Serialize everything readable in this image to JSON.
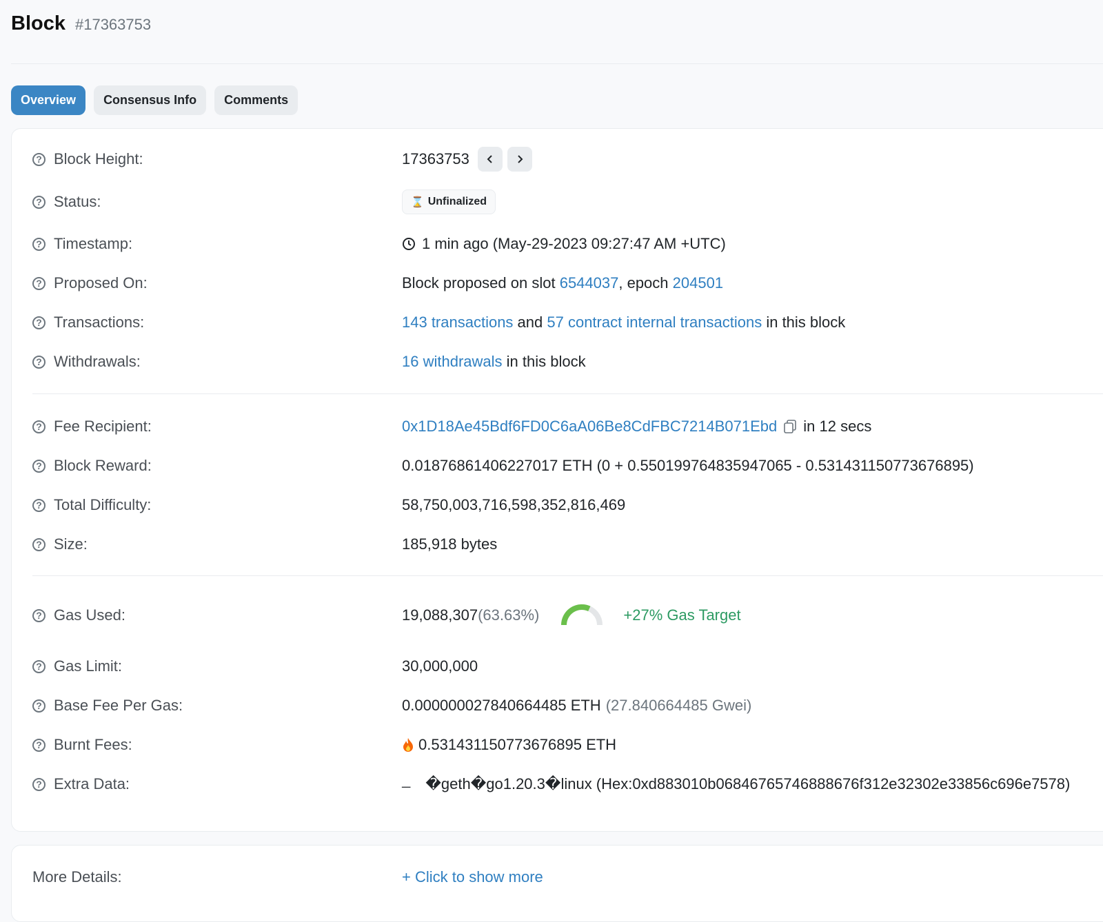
{
  "header": {
    "title": "Block",
    "block_number": "#17363753"
  },
  "tabs": [
    {
      "label": "Overview",
      "active": true
    },
    {
      "label": "Consensus Info",
      "active": false
    },
    {
      "label": "Comments",
      "active": false
    }
  ],
  "rows": {
    "block_height": {
      "label": "Block Height:",
      "value": "17363753",
      "prev_icon": "chevron-left-icon",
      "next_icon": "chevron-right-icon"
    },
    "status": {
      "label": "Status:",
      "value": "Unfinalized",
      "icon": "hourglass-icon"
    },
    "timestamp": {
      "label": "Timestamp:",
      "value": "1 min ago (May-29-2023 09:27:47 AM +UTC)",
      "icon": "clock-icon"
    },
    "proposed_on": {
      "label": "Proposed On:",
      "prefix": "Block proposed on slot ",
      "slot": "6544037",
      "mid": ", epoch ",
      "epoch": "204501"
    },
    "transactions": {
      "label": "Transactions:",
      "tx_link": "143 transactions",
      "and": " and ",
      "internal_link": "57 contract internal transactions",
      "suffix": " in this block"
    },
    "withdrawals": {
      "label": "Withdrawals:",
      "link": "16 withdrawals",
      "suffix": " in this block"
    },
    "fee_recipient": {
      "label": "Fee Recipient:",
      "address": "0x1D18Ae45Bdf6FD0C6aA06Be8CdFBC7214B071Ebd",
      "suffix": "in 12 secs",
      "icon": "copy-icon"
    },
    "block_reward": {
      "label": "Block Reward:",
      "value": "0.01876861406227017 ETH (0 + 0.550199764835947065 - 0.531431150773676895)"
    },
    "total_difficulty": {
      "label": "Total Difficulty:",
      "value": "58,750,003,716,598,352,816,469"
    },
    "size": {
      "label": "Size:",
      "value": "185,918 bytes"
    },
    "gas_used": {
      "label": "Gas Used:",
      "value": "19,088,307",
      "percent": "(63.63%)",
      "gauge_fraction": 0.6363,
      "target": "+27% Gas Target",
      "gauge_color": "#6abf4b"
    },
    "gas_limit": {
      "label": "Gas Limit:",
      "value": "30,000,000"
    },
    "base_fee": {
      "label": "Base Fee Per Gas:",
      "value": "0.000000027840664485 ETH",
      "gwei": "(27.840664485 Gwei)"
    },
    "burnt_fees": {
      "label": "Burnt Fees:",
      "value": "0.531431150773676895 ETH",
      "icon": "fire-icon"
    },
    "extra_data": {
      "label": "Extra Data:",
      "raw_glyph": "ـــ",
      "value": "�geth�go1.20.3�linux (Hex:0xd883010b06846765746888676f312e32302e33856c696e7578)"
    }
  },
  "more_details": {
    "label": "More Details:",
    "link": "+ Click to show more"
  },
  "colors": {
    "accent": "#3b86c4",
    "link": "#2f7fc1",
    "green": "#2c9a62"
  }
}
